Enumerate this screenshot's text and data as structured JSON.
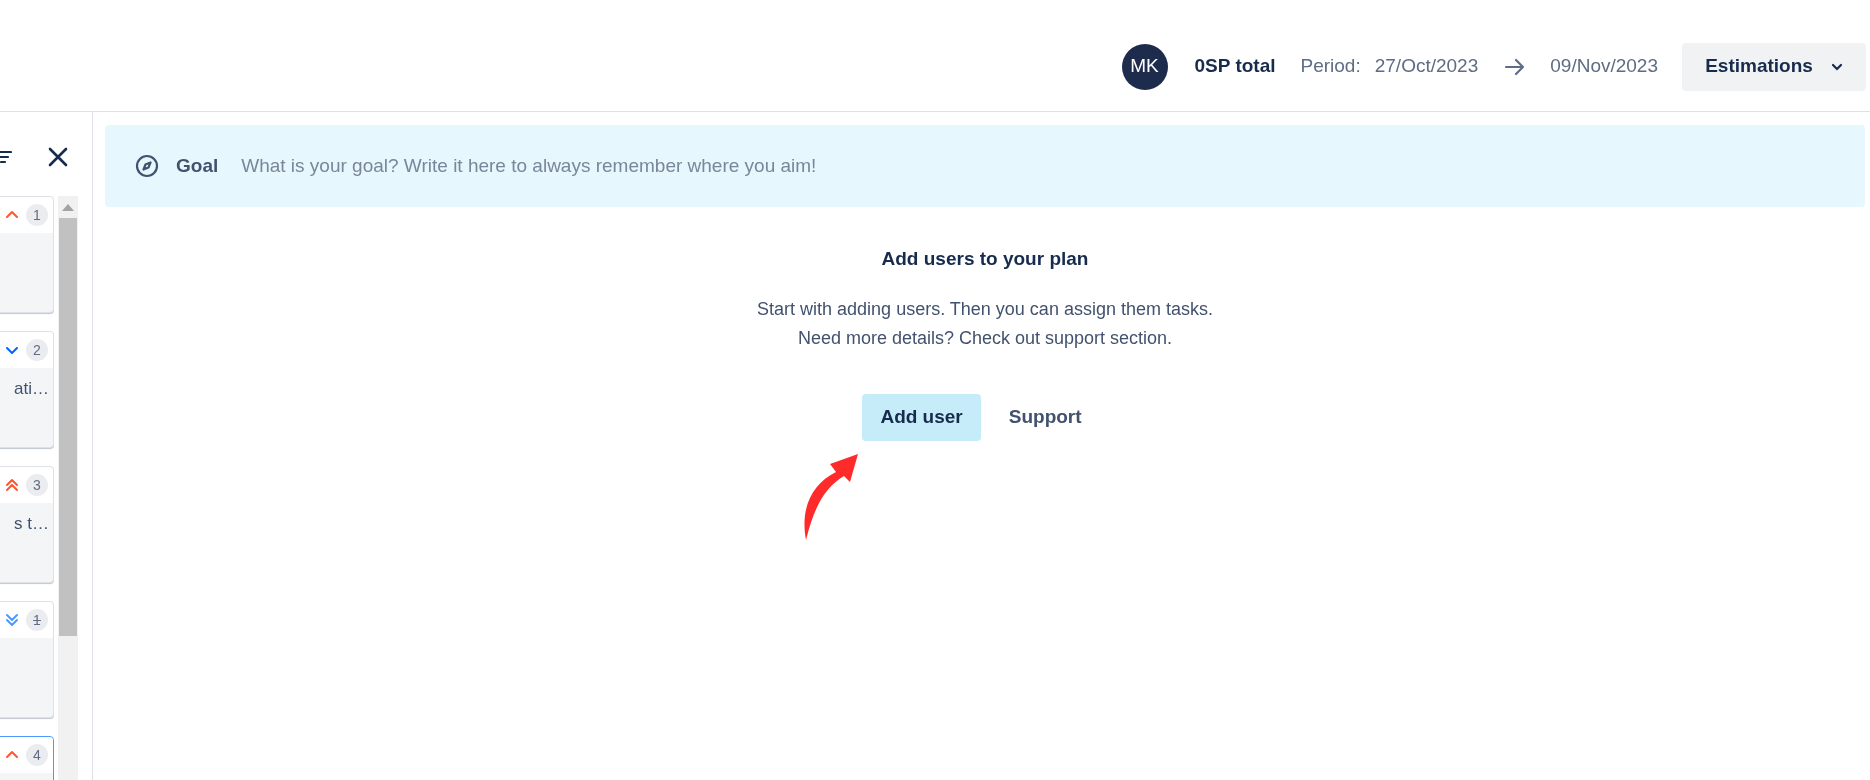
{
  "header": {
    "avatar": "MK",
    "total": "0SP total",
    "period_label": "Period:",
    "start": "27/Oct/2023",
    "end": "09/Nov/2023",
    "view_button": "Estimations"
  },
  "sidebar": {
    "cards": [
      {
        "kind": "high",
        "number": "1",
        "struck": false,
        "selected": false
      },
      {
        "kind": "low",
        "number": "2",
        "struck": false,
        "text": "ati…",
        "selected": false
      },
      {
        "kind": "highest",
        "number": "3",
        "struck": false,
        "text": "s t…",
        "selected": false
      },
      {
        "kind": "lowest",
        "number": "1",
        "struck": true,
        "selected": false
      },
      {
        "kind": "high",
        "number": "4",
        "struck": false,
        "selected": true
      }
    ]
  },
  "goal": {
    "label": "Goal",
    "placeholder": "What is your goal? Write it here to always remember where you aim!"
  },
  "empty_state": {
    "title": "Add users to your plan",
    "lines": [
      "Start with adding users. Then you can assign them tasks.",
      "Need more details? Check out support section."
    ],
    "primary_button": "Add user",
    "secondary_button": "Support"
  }
}
